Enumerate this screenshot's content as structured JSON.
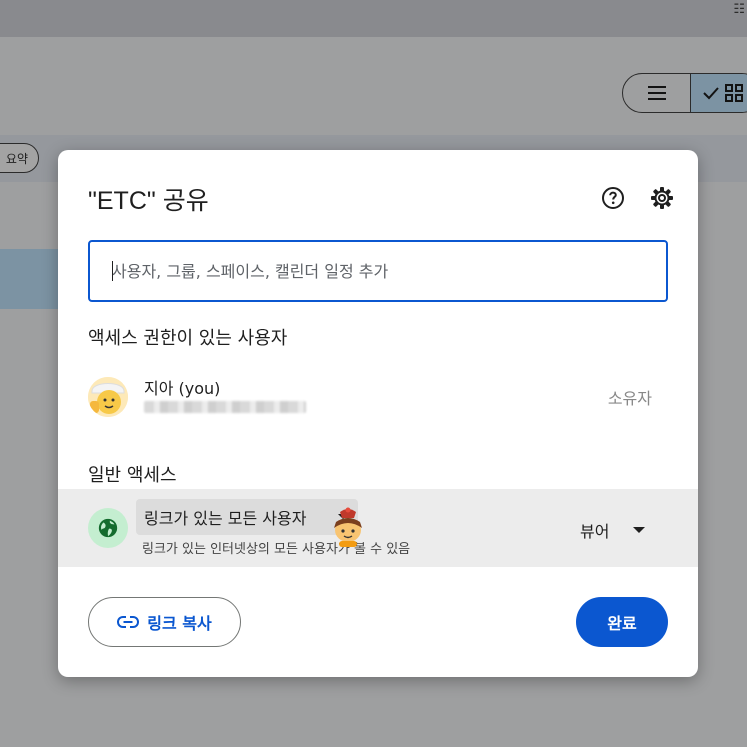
{
  "background": {
    "summary_chip_label": "요약",
    "view_toggle": {
      "list_icon": "hamburger-icon",
      "grid_icon": "grid-icon",
      "selected": "grid"
    }
  },
  "dialog": {
    "title": "\"ETC\" 공유",
    "help_icon": "help-circle-icon",
    "settings_icon": "gear-icon",
    "share_input": {
      "placeholder": "사용자, 그룹, 스페이스, 캘린더 일정 추가",
      "value": ""
    },
    "access_section_title": "액세스 권한이 있는 사용자",
    "users": [
      {
        "name": "지아 (you)",
        "role": "소유자"
      }
    ],
    "general_access_title": "일반 액세스",
    "general_access": {
      "scope": "링크가 있는 모든 사용자",
      "description": "링크가 있는 인터넷상의 모든 사용자가 볼 수 있음",
      "role": "뷰어"
    },
    "copy_link_label": "링크 복사",
    "done_label": "완료"
  },
  "colors": {
    "primary": "#0b57d0",
    "globe_bg": "#c4eed0",
    "globe_icon": "#146c2e"
  }
}
